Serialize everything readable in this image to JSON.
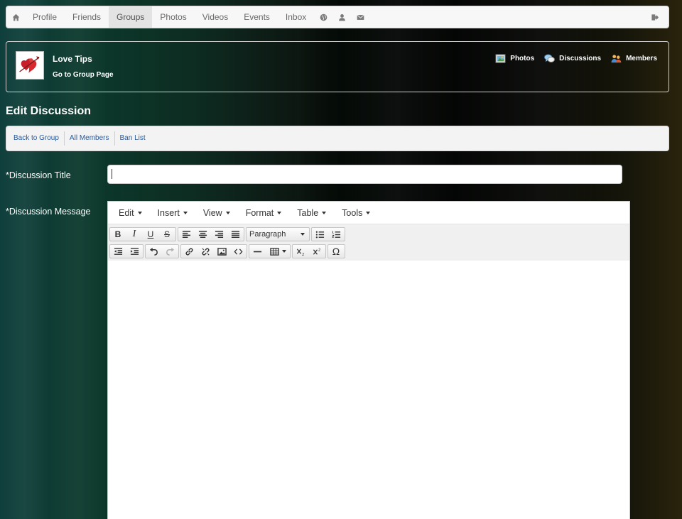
{
  "topnav": {
    "items": [
      {
        "label": "Profile"
      },
      {
        "label": "Friends"
      },
      {
        "label": "Groups",
        "active": true
      },
      {
        "label": "Photos"
      },
      {
        "label": "Videos"
      },
      {
        "label": "Events"
      },
      {
        "label": "Inbox"
      }
    ],
    "icons": [
      "home-icon",
      "globe-icon",
      "user-icon",
      "envelope-icon",
      "sign-out-icon"
    ]
  },
  "group": {
    "name": "Love Tips",
    "page_link": "Go to Group Page",
    "links": [
      {
        "label": "Photos",
        "icon": "photos-icon"
      },
      {
        "label": "Discussions",
        "icon": "discussions-icon"
      },
      {
        "label": "Members",
        "icon": "members-icon"
      }
    ]
  },
  "page": {
    "title": "Edit Discussion"
  },
  "subnav": {
    "links": [
      "Back to Group",
      "All Members",
      "Ban List"
    ]
  },
  "form": {
    "title_label": "*Discussion Title",
    "title_value": "",
    "message_label": "*Discussion Message"
  },
  "editor": {
    "menu": [
      "Edit",
      "Insert",
      "View",
      "Format",
      "Table",
      "Tools"
    ],
    "format_select": "Paragraph",
    "bold_glyph": "B",
    "italic_glyph": "I",
    "underline_glyph": "U",
    "strike_glyph": "S",
    "special_char_glyph": "Ω"
  },
  "colors": {
    "link": "#2a5a9a",
    "nav_bg": "#f7f7f7"
  }
}
